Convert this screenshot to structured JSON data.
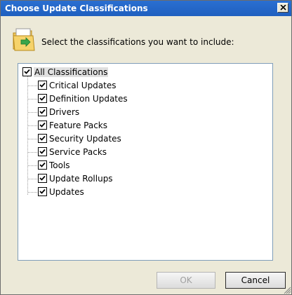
{
  "window": {
    "title": "Choose Update Classifications",
    "close_label": "✕"
  },
  "prompt": {
    "text": "Select the classifications you want to include:",
    "icon": "folder-icon"
  },
  "tree": {
    "root": {
      "label": "All Classifications",
      "checked": true
    },
    "items": [
      {
        "label": "Critical Updates",
        "checked": true
      },
      {
        "label": "Definition Updates",
        "checked": true
      },
      {
        "label": "Drivers",
        "checked": true
      },
      {
        "label": "Feature Packs",
        "checked": true
      },
      {
        "label": "Security Updates",
        "checked": true
      },
      {
        "label": "Service Packs",
        "checked": true
      },
      {
        "label": "Tools",
        "checked": true
      },
      {
        "label": "Update Rollups",
        "checked": true
      },
      {
        "label": "Updates",
        "checked": true
      }
    ]
  },
  "buttons": {
    "ok_label": "OK",
    "ok_enabled": false,
    "cancel_label": "Cancel"
  },
  "colors": {
    "title_bar": "#1f5fbf",
    "dialog_bg": "#ece9d8",
    "tree_border": "#7f9db9"
  }
}
